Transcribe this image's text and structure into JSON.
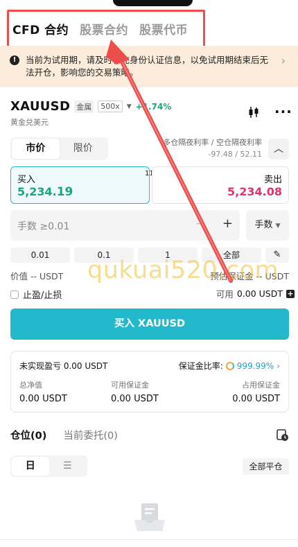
{
  "top_tabs": [
    {
      "label": "CFD 合约",
      "active": true
    },
    {
      "label": "股票合约",
      "active": false
    },
    {
      "label": "股票代币",
      "active": false
    }
  ],
  "notice": {
    "text": "当前为试用期，请及时补充身份认证信息，以免试用期结束后无法开仓，影响您的交易策略。",
    "icon": "warning-icon"
  },
  "instrument": {
    "symbol": "XAUUSD",
    "category": "金属",
    "leverage": "500x",
    "change": "+1.74%",
    "name": "黄金兑美元"
  },
  "order_types": [
    {
      "label": "市价",
      "active": true
    },
    {
      "label": "限价",
      "active": false
    }
  ],
  "funding": {
    "label": "多仓隔夜利率 / 空仓隔夜利率",
    "value": "-97.48 / 52.11"
  },
  "quote": {
    "buy_label": "买入",
    "buy_price_main": "5,234.",
    "buy_price_tail": "19",
    "spread": "11",
    "sell_label": "卖出",
    "sell_price_main": "5,234.",
    "sell_price_tail": "08"
  },
  "quantity": {
    "placeholder": "手数 ≥0.01",
    "minus": "−",
    "plus": "+",
    "unit": "手数"
  },
  "quick_amounts": [
    "0.01",
    "0.1",
    "1",
    "全部"
  ],
  "order_info": {
    "value_label": "价值 -- USDT",
    "margin_label": "预估保证金 -- USDT",
    "tpsl_label": "止盈/止损",
    "available_label": "可用",
    "available_amount": "0.00 USDT"
  },
  "buy_button": "买入 XAUUSD",
  "account": {
    "unrealized_pnl_label": "未实现盈亏",
    "unrealized_pnl": "0.00 USDT",
    "margin_ratio_label": "保证金比率:",
    "margin_ratio": "999.99%",
    "equity_label": "总净值",
    "equity": "0.00 USDT",
    "available_margin_label": "可用保证金",
    "available_margin": "0.00 USDT",
    "used_margin_label": "占用保证金",
    "used_margin": "0.00 USDT"
  },
  "position_tabs": [
    {
      "label": "仓位(0)",
      "active": true
    },
    {
      "label": "当前委托(0)",
      "active": false
    }
  ],
  "view_toggle": [
    "日",
    "☰"
  ],
  "close_all": "全部平仓",
  "watermark": "qukuai520.com",
  "colors": {
    "accent": "#22b9cc",
    "buy_green": "#1aa67a",
    "sell_red": "#e0356c",
    "annotation_red": "#ef4c4c",
    "notice_bg": "#fbecdc"
  }
}
